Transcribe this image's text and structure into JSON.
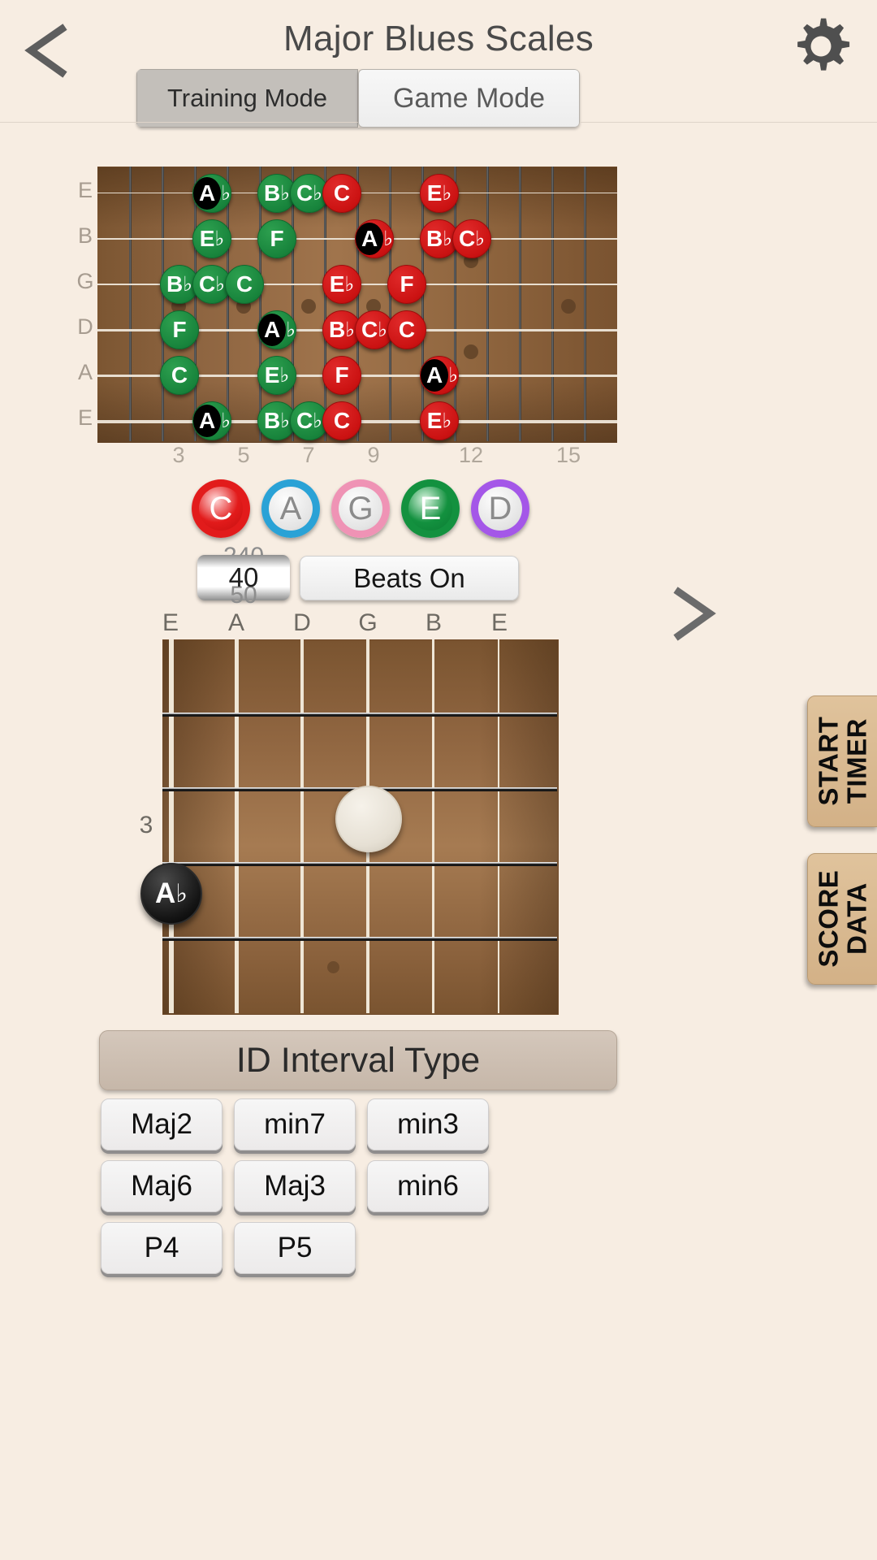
{
  "header": {
    "title": "Major Blues Scales",
    "back_icon": "back-chevron-icon",
    "settings_icon": "gear-icon"
  },
  "mode_switch": {
    "options": [
      {
        "label": "Training Mode",
        "active": false
      },
      {
        "label": "Game Mode",
        "active": true
      }
    ]
  },
  "fretboard_horizontal": {
    "string_labels": [
      "E",
      "B",
      "G",
      "D",
      "A",
      "E"
    ],
    "fret_numbers": [
      "3",
      "5",
      "7",
      "9",
      "12",
      "15"
    ],
    "notes": [
      {
        "string": 0,
        "fret": 4,
        "letter": "A",
        "accidental": "♭",
        "color": "green",
        "root": true
      },
      {
        "string": 0,
        "fret": 6,
        "letter": "B",
        "accidental": "♭",
        "color": "green",
        "root": false
      },
      {
        "string": 0,
        "fret": 7,
        "letter": "C",
        "accidental": "♭",
        "color": "green",
        "root": false
      },
      {
        "string": 0,
        "fret": 8,
        "letter": "C",
        "accidental": "",
        "color": "red",
        "root": false
      },
      {
        "string": 0,
        "fret": 11,
        "letter": "E",
        "accidental": "♭",
        "color": "red",
        "root": false
      },
      {
        "string": 1,
        "fret": 4,
        "letter": "E",
        "accidental": "♭",
        "color": "green",
        "root": false
      },
      {
        "string": 1,
        "fret": 6,
        "letter": "F",
        "accidental": "",
        "color": "green",
        "root": false
      },
      {
        "string": 1,
        "fret": 9,
        "letter": "A",
        "accidental": "♭",
        "color": "red",
        "root": true
      },
      {
        "string": 1,
        "fret": 11,
        "letter": "B",
        "accidental": "♭",
        "color": "red",
        "root": false
      },
      {
        "string": 1,
        "fret": 12,
        "letter": "C",
        "accidental": "♭",
        "color": "red",
        "root": false
      },
      {
        "string": 2,
        "fret": 3,
        "letter": "B",
        "accidental": "♭",
        "color": "green",
        "root": false
      },
      {
        "string": 2,
        "fret": 4,
        "letter": "C",
        "accidental": "♭",
        "color": "green",
        "root": false
      },
      {
        "string": 2,
        "fret": 5,
        "letter": "C",
        "accidental": "",
        "color": "green",
        "root": false
      },
      {
        "string": 2,
        "fret": 8,
        "letter": "E",
        "accidental": "♭",
        "color": "red",
        "root": false
      },
      {
        "string": 2,
        "fret": 10,
        "letter": "F",
        "accidental": "",
        "color": "red",
        "root": false
      },
      {
        "string": 3,
        "fret": 3,
        "letter": "F",
        "accidental": "",
        "color": "green",
        "root": false
      },
      {
        "string": 3,
        "fret": 6,
        "letter": "A",
        "accidental": "♭",
        "color": "green",
        "root": true
      },
      {
        "string": 3,
        "fret": 8,
        "letter": "B",
        "accidental": "♭",
        "color": "red",
        "root": false
      },
      {
        "string": 3,
        "fret": 9,
        "letter": "C",
        "accidental": "♭",
        "color": "red",
        "root": false
      },
      {
        "string": 3,
        "fret": 10,
        "letter": "C",
        "accidental": "",
        "color": "red",
        "root": false
      },
      {
        "string": 4,
        "fret": 3,
        "letter": "C",
        "accidental": "",
        "color": "green",
        "root": false
      },
      {
        "string": 4,
        "fret": 6,
        "letter": "E",
        "accidental": "♭",
        "color": "green",
        "root": false
      },
      {
        "string": 4,
        "fret": 8,
        "letter": "F",
        "accidental": "",
        "color": "red",
        "root": false
      },
      {
        "string": 4,
        "fret": 11,
        "letter": "A",
        "accidental": "♭",
        "color": "red",
        "root": true
      },
      {
        "string": 5,
        "fret": 4,
        "letter": "A",
        "accidental": "♭",
        "color": "green",
        "root": true
      },
      {
        "string": 5,
        "fret": 6,
        "letter": "B",
        "accidental": "♭",
        "color": "green",
        "root": false
      },
      {
        "string": 5,
        "fret": 7,
        "letter": "C",
        "accidental": "♭",
        "color": "green",
        "root": false
      },
      {
        "string": 5,
        "fret": 8,
        "letter": "C",
        "accidental": "",
        "color": "red",
        "root": false
      },
      {
        "string": 5,
        "fret": 11,
        "letter": "E",
        "accidental": "♭",
        "color": "red",
        "root": false
      }
    ]
  },
  "caged": {
    "shapes": [
      {
        "label": "C",
        "state": "on-red",
        "accent": "#e21b1b"
      },
      {
        "label": "A",
        "state": "off",
        "accent": "#2aa2d6"
      },
      {
        "label": "G",
        "state": "off",
        "accent": "#ef93b5"
      },
      {
        "label": "E",
        "state": "on-green",
        "accent": "#13913f"
      },
      {
        "label": "D",
        "state": "off",
        "accent": "#a457e8"
      }
    ]
  },
  "tempo": {
    "prev_value": "240",
    "value": "40",
    "next_value": "50"
  },
  "beats": {
    "label": "Beats On"
  },
  "next_nav": {
    "icon": "forward-chevron-icon"
  },
  "fretboard_vertical": {
    "string_labels": [
      "E",
      "A",
      "D",
      "G",
      "B",
      "E"
    ],
    "fret_number": "3",
    "finger_marker": {
      "string": 3,
      "fret": 2,
      "type": "blank-marker"
    },
    "answer_marker": {
      "string": 0,
      "fret": 3,
      "letter": "A",
      "accidental": "♭"
    }
  },
  "side_buttons": [
    {
      "id": "start-timer",
      "line1": "START",
      "line2": "TIMER"
    },
    {
      "id": "score-data",
      "line1": "SCORE",
      "line2": "DATA"
    }
  ],
  "question": {
    "banner": "ID Interval Type",
    "answers": [
      "Maj2",
      "min7",
      "min3",
      "Maj6",
      "Maj3",
      "min6",
      "P4",
      "P5"
    ]
  },
  "colors": {
    "background": "#f7ede2",
    "note_green": "#18843c",
    "note_red": "#cb1212",
    "fretboard_wood": "#a0744c",
    "side_button": "#d8b88f"
  }
}
